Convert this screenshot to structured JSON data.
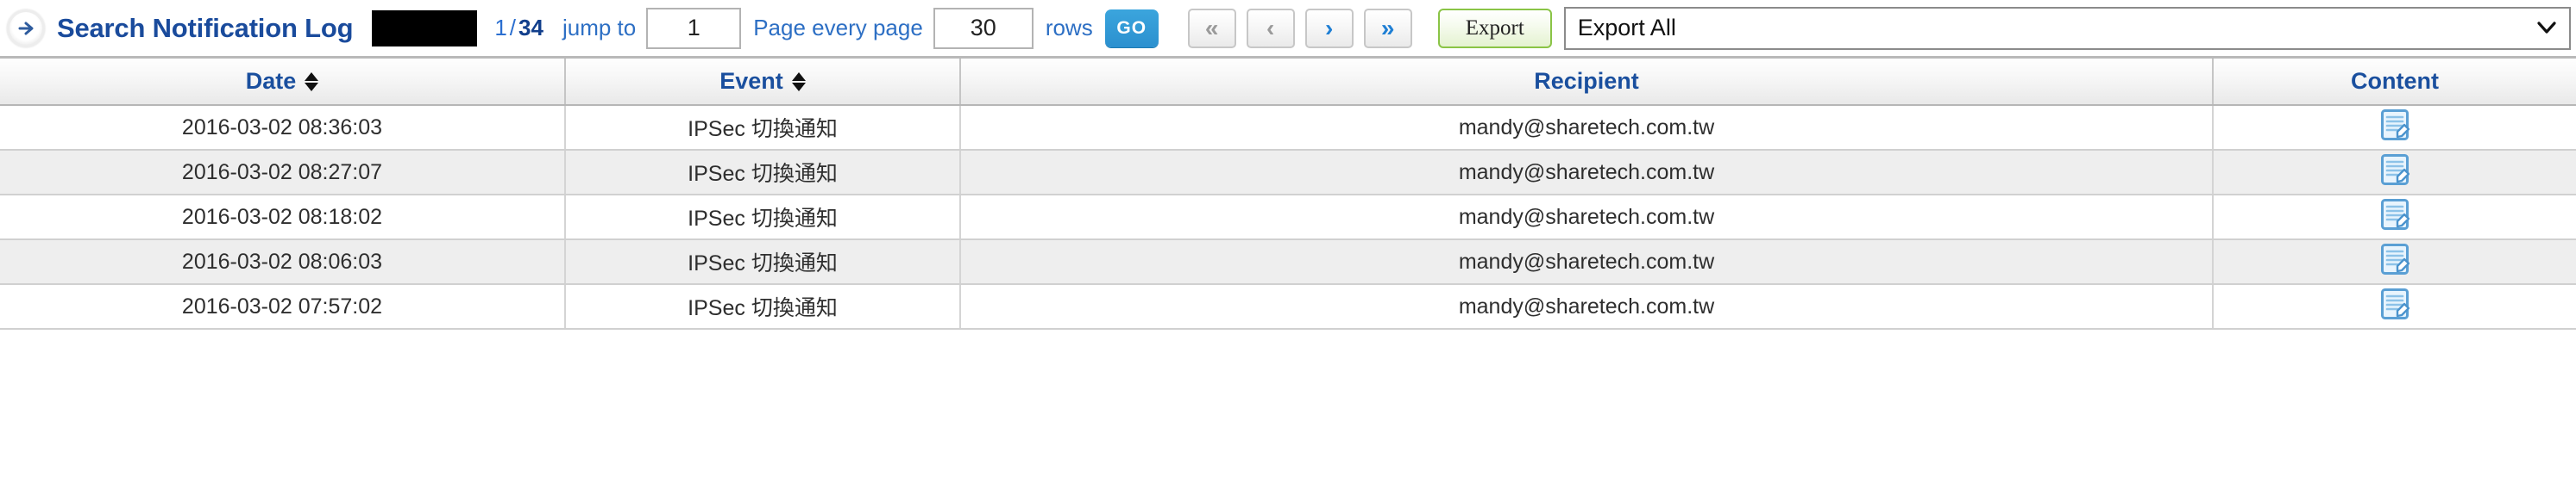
{
  "toolbar": {
    "expand_icon": "circle-right-arrow-icon",
    "title": "Search Notification Log",
    "redacted_field": "",
    "page_current": "1",
    "page_separator": "/",
    "page_total": "34",
    "jump_to_label": "jump to",
    "jump_to_value": "1",
    "page_every_page_label": "Page every page",
    "rows_per_page_value": "30",
    "rows_label": "rows",
    "go_button": "GO",
    "nav": [
      {
        "name": "first-page-button",
        "glyph": "«",
        "state": "disabled"
      },
      {
        "name": "prev-page-button",
        "glyph": "‹",
        "state": "disabled"
      },
      {
        "name": "next-page-button",
        "glyph": "›",
        "state": "enabled"
      },
      {
        "name": "last-page-button",
        "glyph": "»",
        "state": "enabled"
      }
    ],
    "export_button": "Export",
    "export_select_value": "Export All",
    "export_select_chevron": "⌄",
    "colors": {
      "title_blue": "#1a4b9c",
      "link_blue": "#2d6fc4",
      "go_blue": "#2b90cf",
      "export_green_border": "#8ac446",
      "nav_enabled_blue": "#1f7fd4",
      "nav_disabled_gray": "#9a9a9a"
    }
  },
  "table": {
    "columns": [
      {
        "key": "date",
        "label": "Date",
        "sortable": true
      },
      {
        "key": "event",
        "label": "Event",
        "sortable": true
      },
      {
        "key": "recipient",
        "label": "Recipient",
        "sortable": false
      },
      {
        "key": "content",
        "label": "Content",
        "sortable": false
      }
    ],
    "rows": [
      {
        "date": "2016-03-02 08:36:03",
        "event": "IPSec 切換通知",
        "recipient": "mandy@sharetech.com.tw",
        "content_icon": "document-edit-icon"
      },
      {
        "date": "2016-03-02 08:27:07",
        "event": "IPSec 切換通知",
        "recipient": "mandy@sharetech.com.tw",
        "content_icon": "document-edit-icon"
      },
      {
        "date": "2016-03-02 08:18:02",
        "event": "IPSec 切換通知",
        "recipient": "mandy@sharetech.com.tw",
        "content_icon": "document-edit-icon"
      },
      {
        "date": "2016-03-02 08:06:03",
        "event": "IPSec 切換通知",
        "recipient": "mandy@sharetech.com.tw",
        "content_icon": "document-edit-icon"
      },
      {
        "date": "2016-03-02 07:57:02",
        "event": "IPSec 切換通知",
        "recipient": "mandy@sharetech.com.tw",
        "content_icon": "document-edit-icon"
      }
    ]
  }
}
